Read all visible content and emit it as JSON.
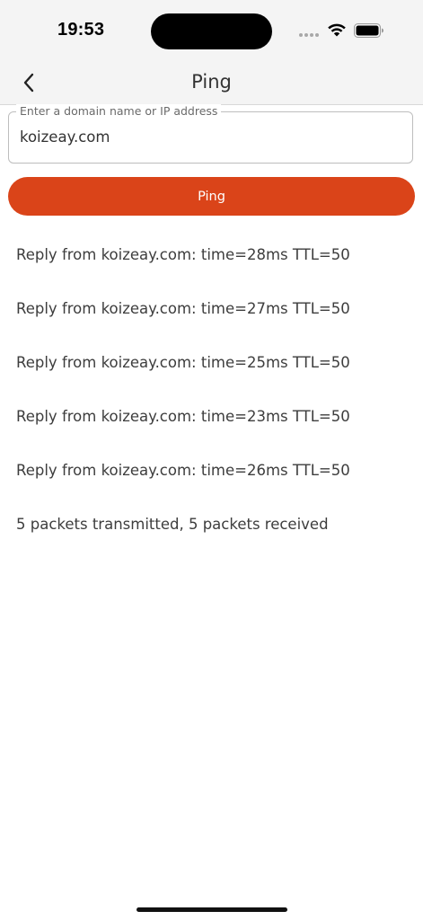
{
  "status_bar": {
    "time": "19:53",
    "icons": [
      "signal-dots-icon",
      "wifi-icon",
      "battery-icon"
    ]
  },
  "nav": {
    "back_icon": "chevron-left-icon",
    "title": "Ping"
  },
  "domain_field": {
    "label": "Enter a domain name or IP address",
    "value": "koizeay.com"
  },
  "ping_button": {
    "label": "Ping",
    "color": "#da4419"
  },
  "results": [
    "Reply from koizeay.com: time=28ms TTL=50",
    "Reply from koizeay.com: time=27ms TTL=50",
    "Reply from koizeay.com: time=25ms TTL=50",
    "Reply from koizeay.com: time=23ms TTL=50",
    "Reply from koizeay.com: time=26ms TTL=50"
  ],
  "summary": "5 packets transmitted, 5 packets received"
}
